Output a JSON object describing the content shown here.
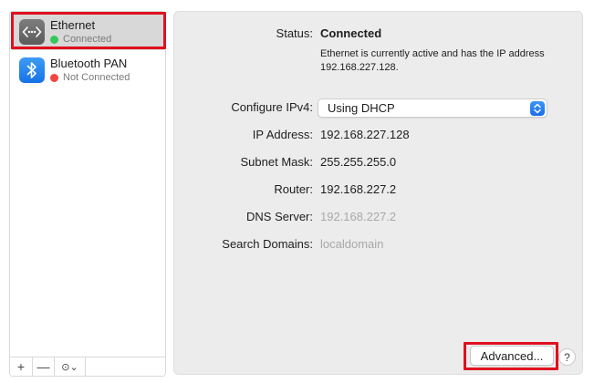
{
  "sidebar": {
    "services": [
      {
        "name": "Ethernet",
        "status": "Connected",
        "status_color": "#34c759",
        "icon": "ethernet-icon"
      },
      {
        "name": "Bluetooth PAN",
        "status": "Not Connected",
        "status_color": "#f2453d",
        "icon": "bluetooth-icon"
      }
    ],
    "add_label": "+",
    "remove_label": "—",
    "action_label": "⊙⌄"
  },
  "main": {
    "status_label": "Status:",
    "status_value": "Connected",
    "status_description": "Ethernet is currently active and has the IP address 192.168.227.128.",
    "configure_label": "Configure IPv4:",
    "configure_value": "Using DHCP",
    "ip_label": "IP Address:",
    "ip_value": "192.168.227.128",
    "subnet_label": "Subnet Mask:",
    "subnet_value": "255.255.255.0",
    "router_label": "Router:",
    "router_value": "192.168.227.2",
    "dns_label": "DNS Server:",
    "dns_value": "192.168.227.2",
    "search_label": "Search Domains:",
    "search_value": "localdomain",
    "advanced_label": "Advanced...",
    "help_label": "?"
  },
  "colors": {
    "highlight": "#e0101e",
    "accent": "#1c6ee8"
  }
}
